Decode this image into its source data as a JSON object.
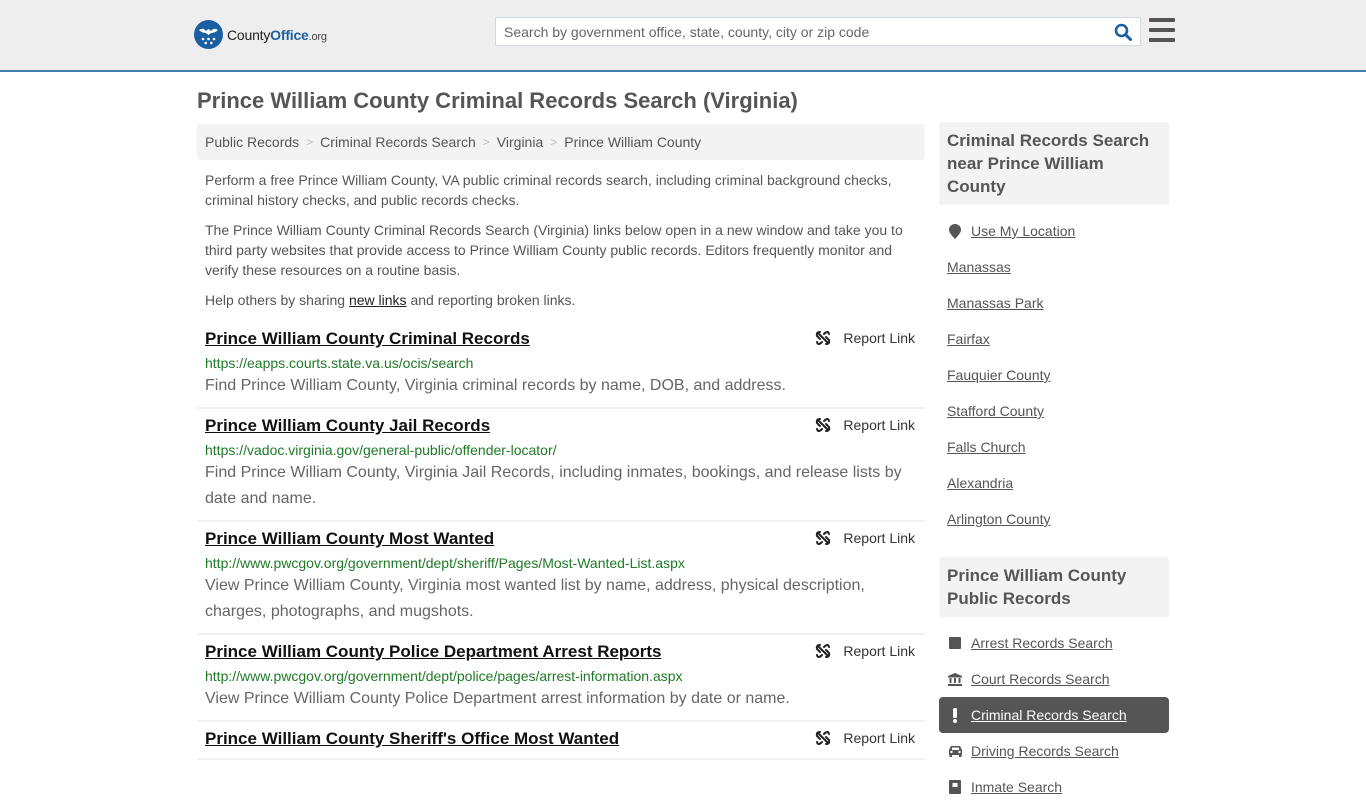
{
  "header": {
    "logo": {
      "brand_prefix": "County",
      "brand_main": "Office",
      "brand_suffix": ".org"
    },
    "search": {
      "placeholder": "Search by government office, state, county, city or zip code",
      "value": ""
    },
    "colors": {
      "accent": "#1b5fa3",
      "header_border": "#3c7dac",
      "url_green": "#1f7a28"
    }
  },
  "page": {
    "title": "Prince William County Criminal Records Search (Virginia)"
  },
  "breadcrumb": [
    "Public Records",
    "Criminal Records Search",
    "Virginia",
    "Prince William County"
  ],
  "breadcrumb_sep": ">",
  "intro": {
    "p1": "Perform a free Prince William County, VA public criminal records search, including criminal background checks, criminal history checks, and public records checks.",
    "p2": "The Prince William County Criminal Records Search (Virginia) links below open in a new window and take you to third party websites that provide access to Prince William County public records. Editors frequently monitor and verify these resources on a routine basis.",
    "p3_before": "Help others by sharing ",
    "p3_link": "new links",
    "p3_after": " and reporting broken links."
  },
  "results": [
    {
      "title": "Prince William County Criminal Records",
      "url": "https://eapps.courts.state.va.us/ocis/search",
      "desc": "Find Prince William County, Virginia criminal records by name, DOB, and address.",
      "report_label": "Report Link"
    },
    {
      "title": "Prince William County Jail Records",
      "url": "https://vadoc.virginia.gov/general-public/offender-locator/",
      "desc": "Find Prince William County, Virginia Jail Records, including inmates, bookings, and release lists by date and name.",
      "report_label": "Report Link"
    },
    {
      "title": "Prince William County Most Wanted",
      "url": "http://www.pwcgov.org/government/dept/sheriff/Pages/Most-Wanted-List.aspx",
      "desc": "View Prince William County, Virginia most wanted list by name, address, physical description, charges, photographs, and mugshots.",
      "report_label": "Report Link"
    },
    {
      "title": "Prince William County Police Department Arrest Reports",
      "url": "http://www.pwcgov.org/government/dept/police/pages/arrest-information.aspx",
      "desc": "View Prince William County Police Department arrest information by date or name.",
      "report_label": "Report Link"
    },
    {
      "title": "Prince William County Sheriff's Office Most Wanted",
      "url": "",
      "desc": "",
      "report_label": "Report Link"
    }
  ],
  "sidebar": {
    "nearby": {
      "heading": "Criminal Records Search near Prince William County",
      "use_location": "Use My Location",
      "places": [
        "Manassas",
        "Manassas Park",
        "Fairfax",
        "Fauquier County",
        "Stafford County",
        "Falls Church",
        "Alexandria",
        "Arlington County"
      ]
    },
    "public_records": {
      "heading": "Prince William County Public Records",
      "items": [
        {
          "label": "Arrest Records Search",
          "icon": "square-icon",
          "active": false
        },
        {
          "label": "Court Records Search",
          "icon": "courthouse-icon",
          "active": false
        },
        {
          "label": "Criminal Records Search",
          "icon": "exclamation-icon",
          "active": true
        },
        {
          "label": "Driving Records Search",
          "icon": "car-icon",
          "active": false
        },
        {
          "label": "Inmate Search",
          "icon": "inmate-icon",
          "active": false
        }
      ]
    }
  }
}
